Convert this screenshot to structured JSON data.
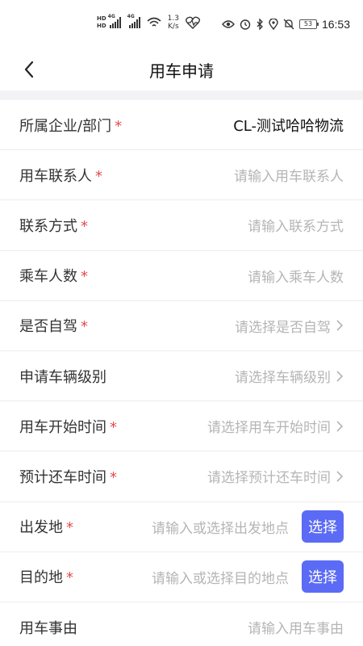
{
  "status_bar": {
    "hd_top": "HD",
    "hd_bottom": "HD",
    "signal1_tag": "4G",
    "signal2_tag": "4G",
    "speed_value": "1.3",
    "speed_unit": "K/s",
    "battery": "53",
    "time": "16:53"
  },
  "header": {
    "title": "用车申请"
  },
  "form": {
    "rows": [
      {
        "label": "所属企业/部门",
        "required": "*",
        "value": "CL-测试哈哈物流"
      },
      {
        "label": "用车联系人",
        "required": "*",
        "placeholder": "请输入用车联系人"
      },
      {
        "label": "联系方式",
        "required": "*",
        "placeholder": "请输入联系方式"
      },
      {
        "label": "乘车人数",
        "required": "*",
        "placeholder": "请输入乘车人数"
      },
      {
        "label": "是否自驾",
        "required": "*",
        "placeholder": "请选择是否自驾"
      },
      {
        "label": "申请车辆级别",
        "required": "",
        "placeholder": "请选择车辆级别"
      },
      {
        "label": "用车开始时间",
        "required": "*",
        "placeholder": "请选择用车开始时间"
      },
      {
        "label": "预计还车时间",
        "required": "*",
        "placeholder": "请选择预计还车时间"
      },
      {
        "label": "出发地",
        "required": "*",
        "placeholder": "请输入或选择出发地点",
        "button": "选择"
      },
      {
        "label": "目的地",
        "required": "*",
        "placeholder": "请输入或选择目的地点",
        "button": "选择"
      },
      {
        "label": "用车事由",
        "required": "",
        "placeholder": "请输入用车事由"
      }
    ]
  },
  "colors": {
    "accent": "#5b6bf5",
    "required": "#e24b4b",
    "placeholder": "#b5b5b5"
  }
}
